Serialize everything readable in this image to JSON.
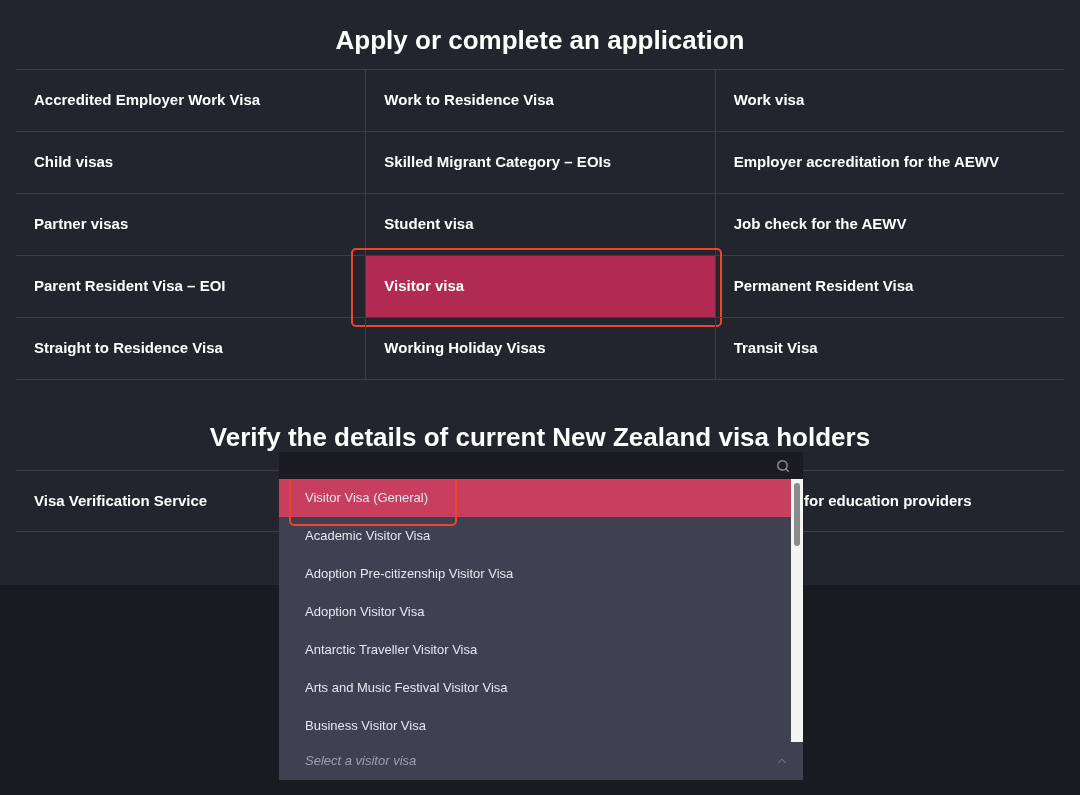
{
  "apply_section": {
    "title": "Apply or complete an application",
    "items": [
      {
        "label": "Accredited Employer Work Visa",
        "selected": false,
        "annotated": false
      },
      {
        "label": "Work to Residence Visa",
        "selected": false,
        "annotated": false
      },
      {
        "label": "Work visa",
        "selected": false,
        "annotated": false
      },
      {
        "label": "Child visas",
        "selected": false,
        "annotated": false
      },
      {
        "label": "Skilled Migrant Category – EOIs",
        "selected": false,
        "annotated": false
      },
      {
        "label": "Employer accreditation for the AEWV",
        "selected": false,
        "annotated": false
      },
      {
        "label": "Partner visas",
        "selected": false,
        "annotated": false
      },
      {
        "label": "Student visa",
        "selected": false,
        "annotated": false
      },
      {
        "label": "Job check for the AEWV",
        "selected": false,
        "annotated": false
      },
      {
        "label": "Parent Resident Visa – EOI",
        "selected": false,
        "annotated": false
      },
      {
        "label": "Visitor visa",
        "selected": true,
        "annotated": true
      },
      {
        "label": "Permanent Resident Visa",
        "selected": false,
        "annotated": false
      },
      {
        "label": "Straight to Residence Visa",
        "selected": false,
        "annotated": false
      },
      {
        "label": "Working Holiday Visas",
        "selected": false,
        "annotated": false
      },
      {
        "label": "Transit Visa",
        "selected": false,
        "annotated": false
      }
    ]
  },
  "verify_section": {
    "title": "Verify the details of current New Zealand visa holders",
    "items": [
      {
        "label": "Visa Verification Service"
      },
      {
        "label": "for education providers"
      }
    ]
  },
  "dropdown": {
    "options": [
      {
        "label": "Visitor Visa (General)",
        "selected": true,
        "annotated": true
      },
      {
        "label": "Academic Visitor Visa",
        "selected": false,
        "annotated": false
      },
      {
        "label": "Adoption Pre-citizenship Visitor Visa",
        "selected": false,
        "annotated": false
      },
      {
        "label": "Adoption Visitor Visa",
        "selected": false,
        "annotated": false
      },
      {
        "label": "Antarctic Traveller Visitor Visa",
        "selected": false,
        "annotated": false
      },
      {
        "label": "Arts and Music Festival Visitor Visa",
        "selected": false,
        "annotated": false
      },
      {
        "label": "Business Visitor Visa",
        "selected": false,
        "annotated": false
      }
    ],
    "placeholder": "Select a visitor visa"
  }
}
